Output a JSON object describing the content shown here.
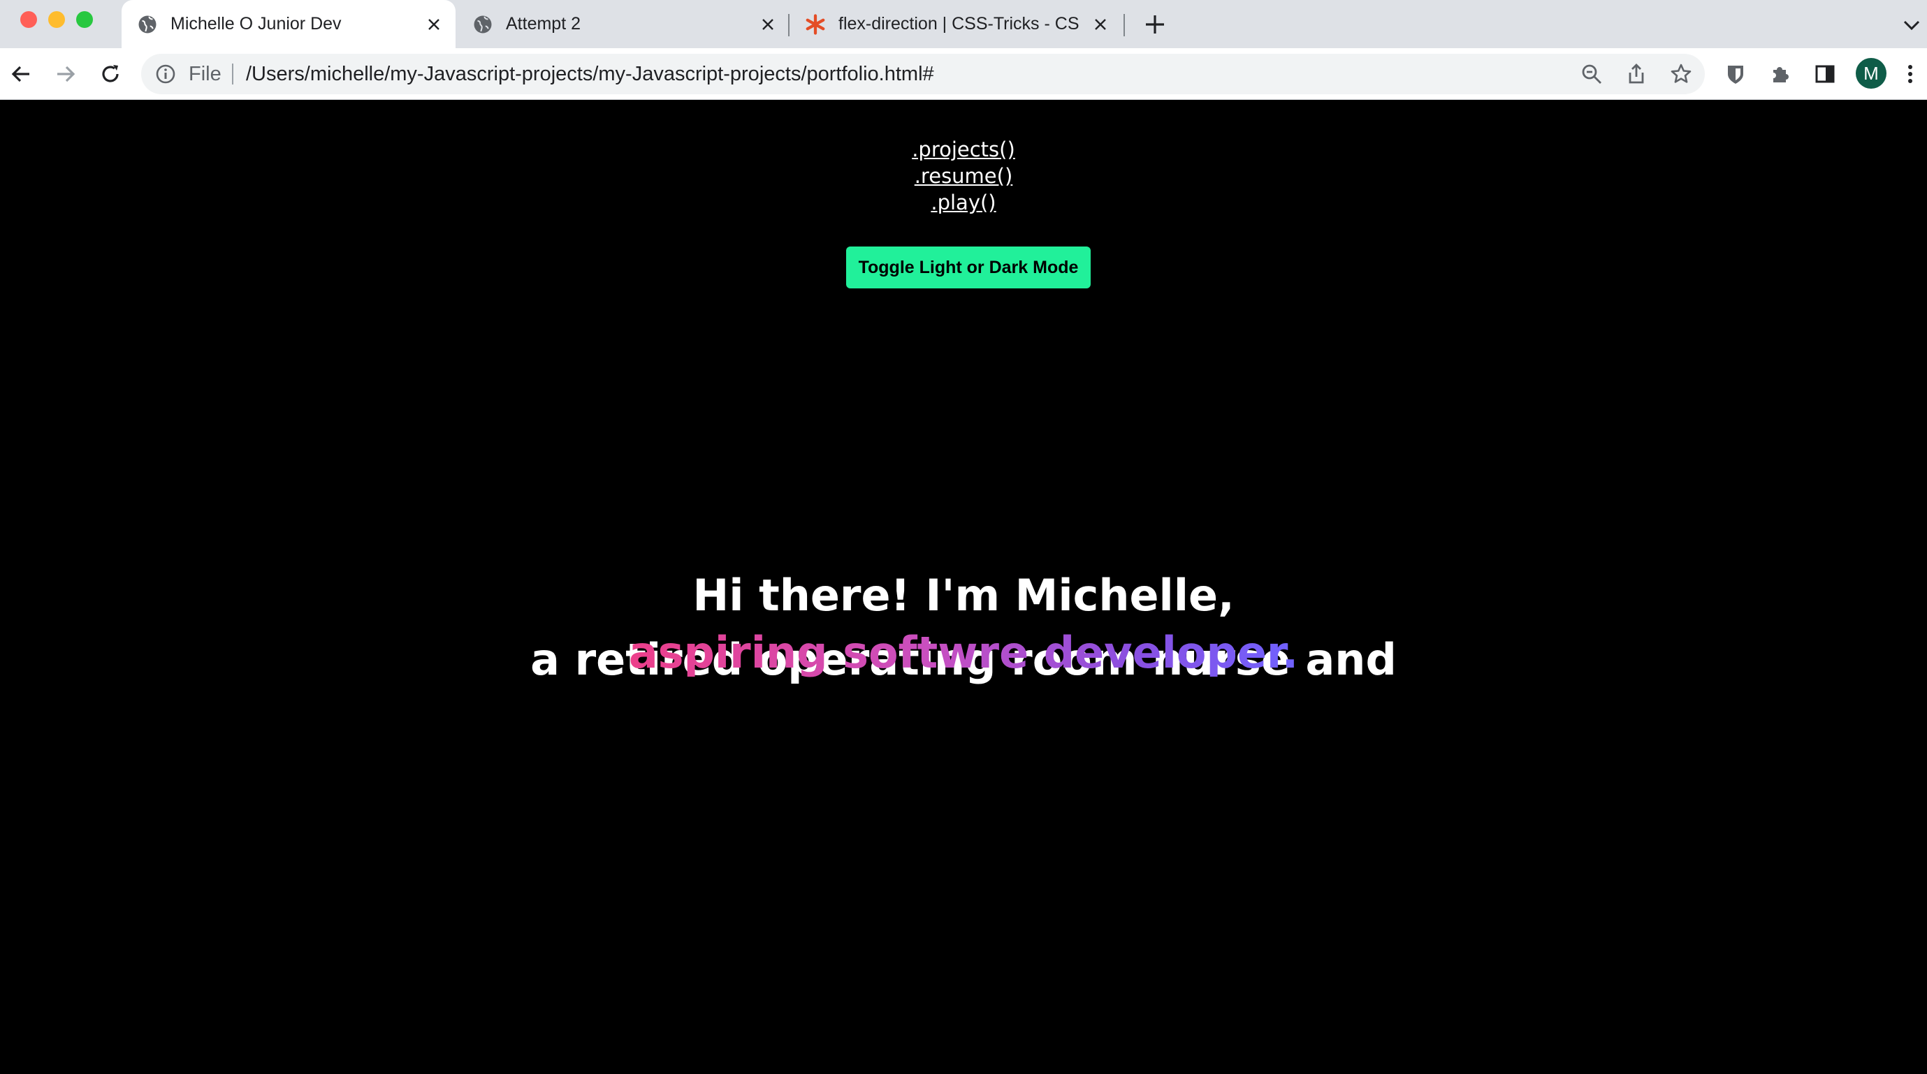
{
  "browser": {
    "tabs": [
      {
        "title": "Michelle O Junior Dev",
        "active": true,
        "favicon": "globe-icon"
      },
      {
        "title": "Attempt 2",
        "active": false,
        "favicon": "globe-icon"
      },
      {
        "title": "flex-direction | CSS-Tricks - CS",
        "active": false,
        "favicon": "asterisk-icon"
      }
    ],
    "omnibox": {
      "scheme_label": "File",
      "url": "/Users/michelle/my-Javascript-projects/my-Javascript-projects/portfolio.html#"
    },
    "profile_initial": "M",
    "colors": {
      "tabstrip": "#dee1e6",
      "avatar": "#0f5c48",
      "accent_star": "#e44d26"
    }
  },
  "page": {
    "nav": {
      "projects": ".projects()",
      "resume": ".resume()",
      "play": ".play()"
    },
    "toggle_button": "Toggle Light or Dark Mode",
    "hero": {
      "line1": "Hi there! I'm Michelle,",
      "line2": "a retired operating room nurse and",
      "gradient_text": "aspiring softwre developer."
    },
    "colors": {
      "background": "#000000",
      "button": "#21f09a",
      "gradient_start": "#ec3f8a",
      "gradient_end": "#6f62ff"
    }
  }
}
